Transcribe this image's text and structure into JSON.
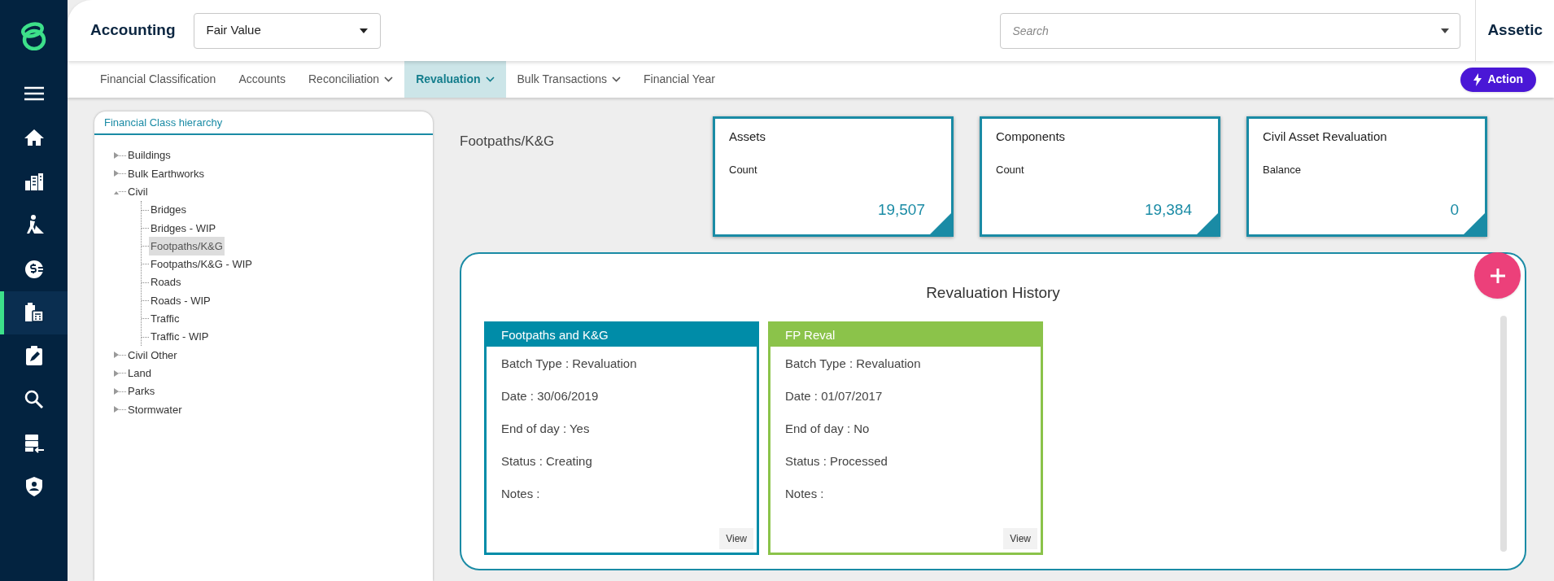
{
  "sidebar": {
    "items": [
      {
        "kind": "menu",
        "selected": false
      },
      {
        "kind": "home",
        "selected": false
      },
      {
        "kind": "buildings",
        "selected": false
      },
      {
        "kind": "worker",
        "selected": false
      },
      {
        "kind": "finance",
        "selected": false
      },
      {
        "kind": "calculator",
        "selected": true
      },
      {
        "kind": "edit",
        "selected": false
      },
      {
        "kind": "search",
        "selected": false
      },
      {
        "kind": "import",
        "selected": false
      },
      {
        "kind": "shield",
        "selected": false
      }
    ]
  },
  "header": {
    "title": "Accounting",
    "module_select": {
      "value": "Fair Value"
    },
    "search": {
      "placeholder": "Search"
    },
    "brand": "Assetic"
  },
  "tabs": [
    {
      "label": "Financial Classification",
      "selected": false,
      "dropdown": false
    },
    {
      "label": "Accounts",
      "selected": false,
      "dropdown": false
    },
    {
      "label": "Reconciliation",
      "selected": false,
      "dropdown": true
    },
    {
      "label": "Revaluation",
      "selected": true,
      "dropdown": true
    },
    {
      "label": "Bulk Transactions",
      "selected": false,
      "dropdown": true
    },
    {
      "label": "Financial Year",
      "selected": false,
      "dropdown": false
    }
  ],
  "action_button": "Action",
  "tree": {
    "title": "Financial Class hierarchy",
    "items": [
      {
        "label": "Buildings",
        "selected": false,
        "expanded": false
      },
      {
        "label": "Bulk Earthworks",
        "selected": false,
        "expanded": false
      },
      {
        "label": "Civil",
        "selected": false,
        "expanded": true,
        "children": [
          {
            "label": "Bridges",
            "selected": false
          },
          {
            "label": "Bridges - WIP",
            "selected": false
          },
          {
            "label": "Footpaths/K&G",
            "selected": true
          },
          {
            "label": "Footpaths/K&G - WIP",
            "selected": false
          },
          {
            "label": "Roads",
            "selected": false
          },
          {
            "label": "Roads - WIP",
            "selected": false
          },
          {
            "label": "Traffic",
            "selected": false
          },
          {
            "label": "Traffic - WIP",
            "selected": false
          }
        ]
      },
      {
        "label": "Civil Other",
        "selected": false,
        "expanded": false
      },
      {
        "label": "Land",
        "selected": false,
        "expanded": false
      },
      {
        "label": "Parks",
        "selected": false,
        "expanded": false
      },
      {
        "label": "Stormwater",
        "selected": false,
        "expanded": false
      }
    ]
  },
  "selected_class": "Footpaths/K&G",
  "stats": [
    {
      "title": "Assets",
      "label": "Count",
      "value": "19,507"
    },
    {
      "title": "Components",
      "label": "Count",
      "value": "19,384"
    },
    {
      "title": "Civil Asset Revaluation",
      "label": "Balance",
      "value": "0"
    }
  ],
  "history": {
    "title": "Revaluation History",
    "cards": [
      {
        "title": "Footpaths and K&G",
        "color": "#008ca8",
        "lines": [
          "Batch Type : Revaluation",
          "Date : 30/06/2019",
          "End of day : Yes",
          "Status : Creating",
          "Notes :"
        ],
        "button": "View"
      },
      {
        "title": "FP Reval",
        "color": "#8bc34a",
        "lines": [
          "Batch Type : Revaluation",
          "Date : 01/07/2017",
          "End of day : No",
          "Status : Processed",
          "Notes :"
        ],
        "button": "View"
      }
    ]
  }
}
